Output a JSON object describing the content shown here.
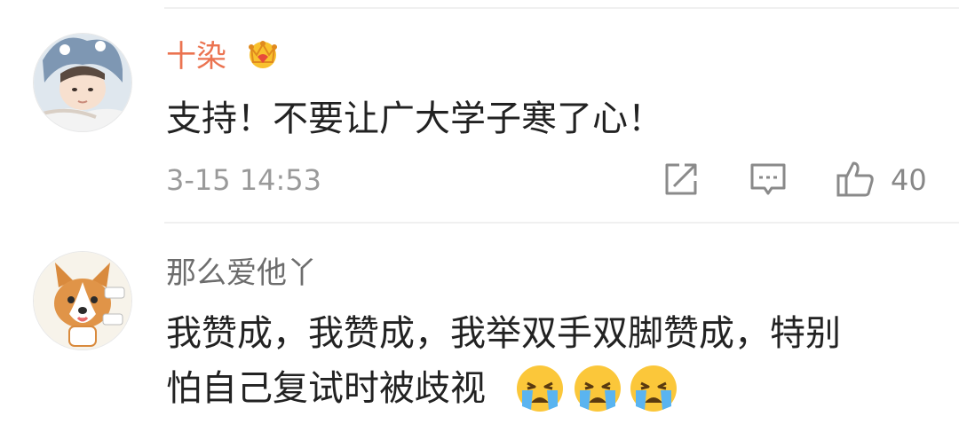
{
  "comments": [
    {
      "username": "十染",
      "text": "支持！不要让广大学子寒了心！",
      "timestamp": "3-15 14:53",
      "likes": "40",
      "username_color": "#eb7350",
      "badge_icon": "vip-crown-icon"
    },
    {
      "username": "那么爱他丫",
      "text_lines": [
        "我赞成，我赞成，我举双手双脚赞成，特别",
        "怕自己复试时被歧视"
      ],
      "emoji_icons": [
        "crying-face-icon",
        "crying-face-icon",
        "crying-face-icon"
      ],
      "username_color": "#6d6d6d"
    }
  ],
  "actions": {
    "share_icon": "share-icon",
    "comment_icon": "comment-icon",
    "like_icon": "thumbs-up-icon"
  }
}
